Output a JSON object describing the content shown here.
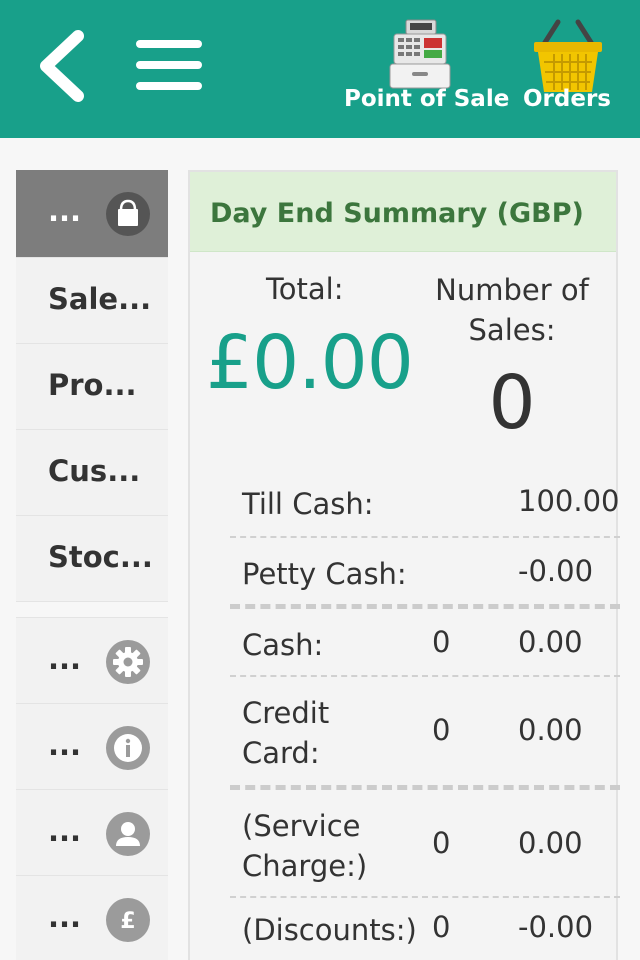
{
  "header": {
    "pos_label": "Point of Sale",
    "orders_label": "Orders",
    "accent": "#18a08a"
  },
  "sidebar": {
    "top_items": [
      {
        "label": "...",
        "icon": "shopping-bag-icon",
        "active": true
      },
      {
        "label": "Sale..."
      },
      {
        "label": "Pro..."
      },
      {
        "label": "Cus..."
      },
      {
        "label": "Stoc..."
      }
    ],
    "bottom_items": [
      {
        "label": "...",
        "icon": "gear-icon"
      },
      {
        "label": "...",
        "icon": "info-icon"
      },
      {
        "label": "...",
        "icon": "user-icon"
      },
      {
        "label": "...",
        "icon": "pound-icon"
      }
    ]
  },
  "summary": {
    "title": "Day End Summary (GBP)",
    "total_label": "Total:",
    "total_value": "£0.00",
    "num_sales_label": "Number of Sales:",
    "num_sales_value": "0",
    "rows": [
      {
        "label": "Till Cash:",
        "count": "",
        "amount": "100.00"
      },
      {
        "label": "Petty Cash:",
        "count": "",
        "amount": "-0.00"
      },
      {
        "label": "Cash:",
        "count": "0",
        "amount": "0.00"
      },
      {
        "label": "Credit Card:",
        "count": "0",
        "amount": "0.00"
      },
      {
        "label": "(Service Charge:)",
        "count": "0",
        "amount": "0.00"
      },
      {
        "label": "(Discounts:)",
        "count": "0",
        "amount": "-0.00"
      }
    ]
  }
}
